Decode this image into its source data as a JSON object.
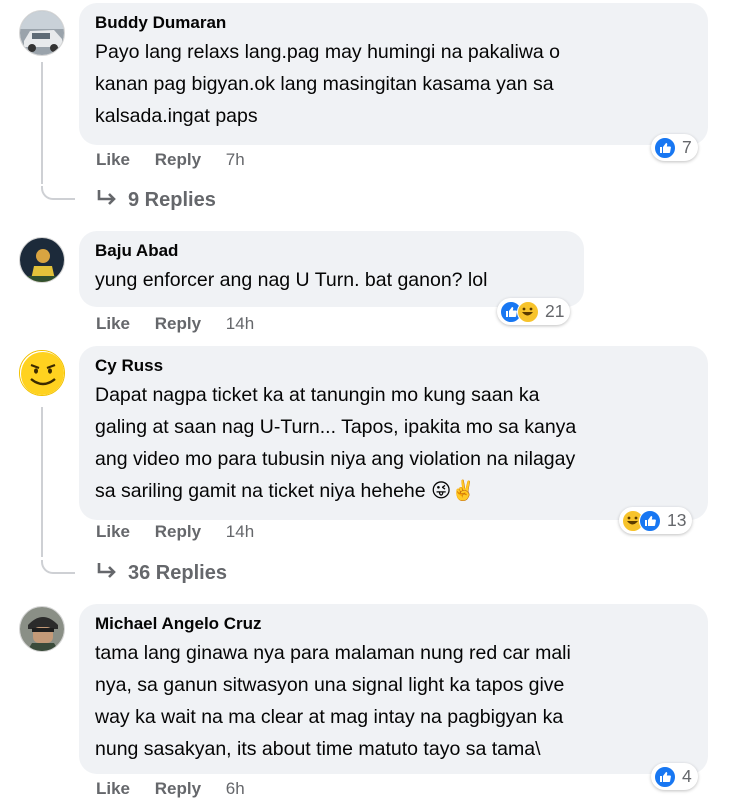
{
  "comments": [
    {
      "author": "Buddy Dumaran",
      "lines": [
        "Payo lang relaxs lang.pag may humingi na pakaliwa o",
        "kanan pag bigyan.ok lang masingitan kasama yan sa",
        "kalsada.ingat paps"
      ],
      "like_label": "Like",
      "reply_label": "Reply",
      "time": "7h",
      "reaction_count": "7",
      "reactions": [
        "like"
      ],
      "replies_label": "9 Replies"
    },
    {
      "author": "Baju Abad",
      "lines": [
        "yung enforcer ang nag U Turn. bat ganon? lol"
      ],
      "like_label": "Like",
      "reply_label": "Reply",
      "time": "14h",
      "reaction_count": "21",
      "reactions": [
        "like",
        "haha"
      ]
    },
    {
      "author": "Cy Russ",
      "lines": [
        "Dapat nagpa ticket ka at tanungin mo kung saan ka",
        "galing at saan nag U-Turn... Tapos, ipakita mo sa kanya",
        "ang video mo para tubusin niya ang violation na nilagay",
        "sa sariling gamit na ticket niya hehehe 😜✌️"
      ],
      "like_label": "Like",
      "reply_label": "Reply",
      "time": "14h",
      "reaction_count": "13",
      "reactions": [
        "haha",
        "like"
      ],
      "replies_label": "36 Replies"
    },
    {
      "author": "Michael Angelo Cruz",
      "lines": [
        "tama lang ginawa nya para malaman nung red car mali",
        "nya, sa ganun sitwasyon una signal light ka tapos give",
        "way ka wait na ma clear at mag intay na pagbigyan ka",
        "nung sasakyan, its about time matuto tayo sa tama\\"
      ],
      "like_label": "Like",
      "reply_label": "Reply",
      "time": "6h",
      "reaction_count": "4",
      "reactions": [
        "like"
      ]
    }
  ]
}
